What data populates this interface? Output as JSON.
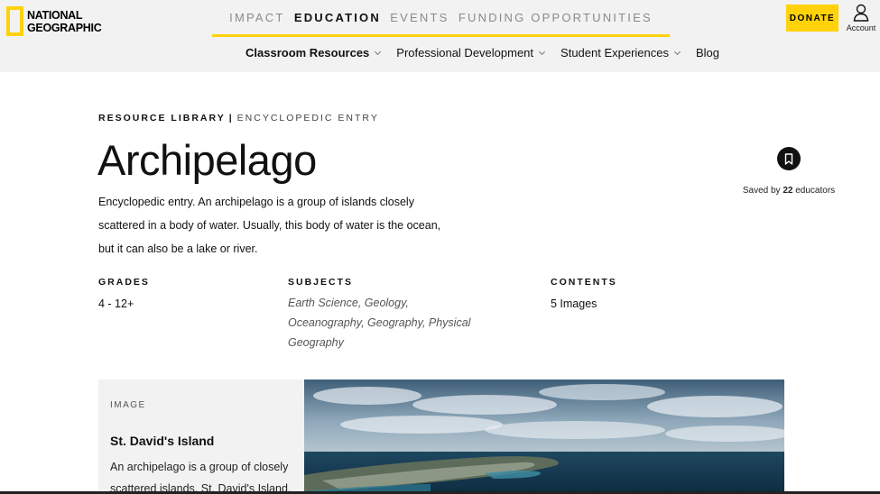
{
  "brand": {
    "line1": "NATIONAL",
    "line2": "GEOGRAPHIC",
    "logo_color": "#ffd20a"
  },
  "top_nav": [
    {
      "label": "IMPACT",
      "active": false
    },
    {
      "label": "EDUCATION",
      "active": true
    },
    {
      "label": "EVENTS",
      "active": false
    },
    {
      "label": "FUNDING OPPORTUNITIES",
      "active": false
    }
  ],
  "sub_nav": [
    {
      "label": "Classroom Resources",
      "has_menu": true
    },
    {
      "label": "Professional Development",
      "has_menu": true
    },
    {
      "label": "Student Experiences",
      "has_menu": true
    },
    {
      "label": "Blog",
      "has_menu": false
    }
  ],
  "actions": {
    "donate_label": "DONATE",
    "account_label": "Account",
    "account_icon": "person-icon"
  },
  "breadcrumb": {
    "section": "RESOURCE LIBRARY",
    "separator": "|",
    "type": "ENCYCLOPEDIC ENTRY"
  },
  "article": {
    "title": "Archipelago",
    "summary": "Encyclopedic entry. An archipelago is a group of islands closely scattered in a body of water. Usually, this body of water is the ocean, but it can also be a lake or river."
  },
  "save": {
    "icon": "bookmark-icon",
    "prefix": "Saved by",
    "count": "22",
    "suffix": "educators"
  },
  "meta": {
    "grades_label": "GRADES",
    "grades_value": "4 - 12+",
    "subjects_label": "SUBJECTS",
    "subjects_value": "Earth Science, Geology, Oceanography, Geography, Physical Geography",
    "contents_label": "CONTENTS",
    "contents_value": "5 Images"
  },
  "image_card": {
    "kind": "IMAGE",
    "title": "St. David's Island",
    "description": "An archipelago is a group of closely scattered islands. St. David's Island,"
  },
  "colors": {
    "accent": "#ffd20a",
    "header_bg": "#f2f2f2",
    "text": "#111111"
  }
}
